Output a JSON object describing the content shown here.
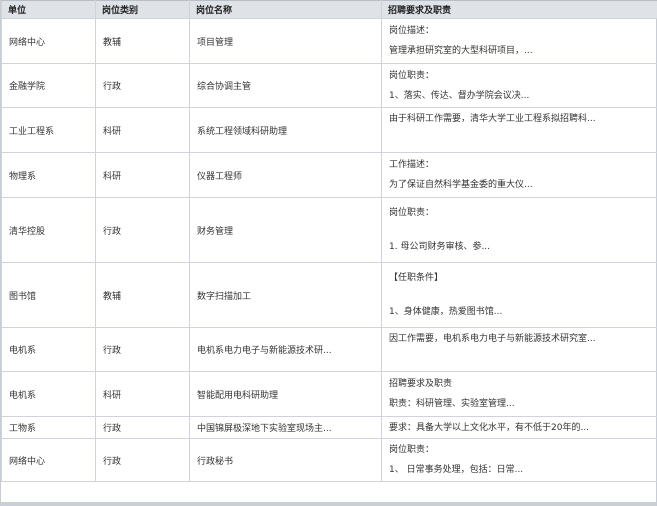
{
  "headers": [
    "单位",
    "岗位类别",
    "岗位名称",
    "招聘要求及职责"
  ],
  "rows": [
    {
      "unit": "网络中心",
      "category": "教辅",
      "title": "项目管理",
      "req": [
        "岗位描述：",
        "管理承担研究室的大型科研项目，..."
      ]
    },
    {
      "unit": "金融学院",
      "category": "行政",
      "title": "综合协调主管",
      "req": [
        "岗位职责：",
        "1、落实、传达、督办学院会议决..."
      ]
    },
    {
      "unit": "工业工程系",
      "category": "科研",
      "title": "系统工程领域科研助理",
      "req": [
        "由于科研工作需要，清华大学工业工程系拟招聘科..."
      ]
    },
    {
      "unit": "物理系",
      "category": "科研",
      "title": "仪器工程师",
      "req": [
        "工作描述：",
        "为了保证自然科学基金委的重大仪..."
      ]
    },
    {
      "unit": "清华控股",
      "category": "行政",
      "title": "财务管理",
      "req": [
        "岗位职责：",
        "1. 母公司财务审核、参..."
      ]
    },
    {
      "unit": "图书馆",
      "category": "教辅",
      "title": "数字扫描加工",
      "req": [
        "【任职条件】",
        "1、身体健康，热爱图书馆..."
      ]
    },
    {
      "unit": "电机系",
      "category": "行政",
      "title": "电机系电力电子与新能源技术研...",
      "req": [
        "因工作需要，电机系电力电子与新能源技术研究室..."
      ]
    },
    {
      "unit": "电机系",
      "category": "科研",
      "title": "智能配用电科研助理",
      "req": [
        "招聘要求及职责",
        "职责：科研管理、实验室管理..."
      ]
    },
    {
      "unit": "工物系",
      "category": "行政",
      "title": "中国锦屏极深地下实验室现场主...",
      "req": [
        "要求：具备大学以上文化水平，有不低于20年的..."
      ]
    },
    {
      "unit": "网络中心",
      "category": "行政",
      "title": "行政秘书",
      "req": [
        "岗位职责：",
        "1、 日常事务处理，包括：日常..."
      ]
    }
  ]
}
